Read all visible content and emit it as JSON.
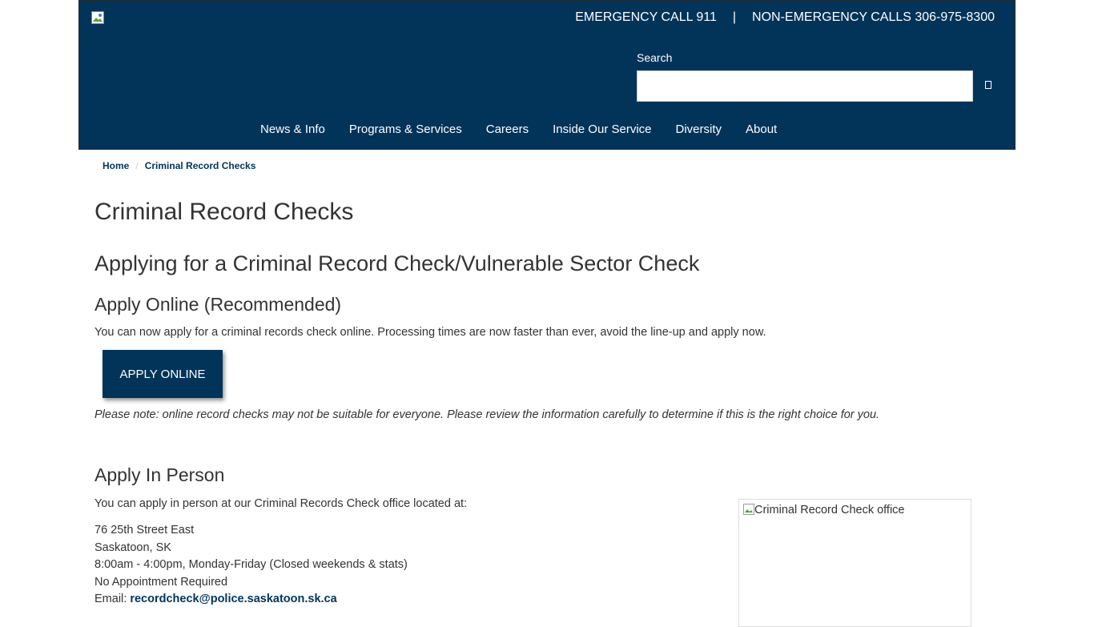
{
  "header": {
    "emergency": "EMERGENCY CALL 911",
    "separator": "|",
    "non_emergency": "NON-EMERGENCY CALLS 306-975-8300",
    "search_label": "Search",
    "search_value": "",
    "search_icon": "search-icon",
    "nav": [
      {
        "label": "News & Info"
      },
      {
        "label": "Programs & Services"
      },
      {
        "label": "Careers"
      },
      {
        "label": "Inside Our Service"
      },
      {
        "label": "Diversity"
      },
      {
        "label": "About"
      }
    ],
    "brand_color": "#02345a"
  },
  "breadcrumb": {
    "home": "Home",
    "divider": "/",
    "current": "Criminal Record Checks"
  },
  "main": {
    "title": "Criminal Record Checks",
    "subtitle": "Applying for a Criminal Record Check/Vulnerable Sector Check",
    "online_heading": "Apply Online (Recommended)",
    "online_text": "You can now apply for a criminal records check online. Processing times are now faster than ever, avoid the line-up and apply now.",
    "apply_button": "APPLY ONLINE",
    "note": "Please note: online record checks may not be suitable for everyone. Please review the information carefully to determine if this is the right choice for you.",
    "person_heading": "Apply In Person",
    "person_text": "You can apply in person at our Criminal Records Check office located at:",
    "address": {
      "street": "76 25th Street East",
      "city": "Saskatoon, SK",
      "hours": "8:00am - 4:00pm, Monday-Friday (Closed weekends & stats)",
      "appointment": "No Appointment Required",
      "email_label": "Email: ",
      "email": "recordcheck@police.saskatoon.sk.ca"
    },
    "office_image_alt": "Criminal Record Check office"
  }
}
